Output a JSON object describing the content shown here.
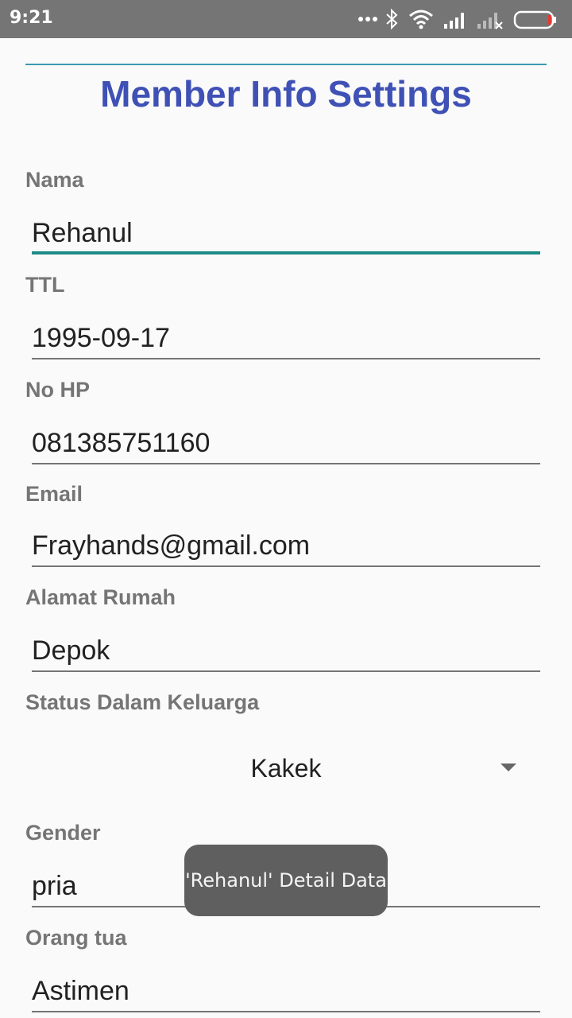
{
  "status_bar": {
    "time": "9:21",
    "icons": [
      "more-dots-icon",
      "bluetooth-icon",
      "wifi-icon",
      "signal-icon",
      "no-signal-icon",
      "battery-icon"
    ]
  },
  "page": {
    "title": "Member Info Settings",
    "accent_color": "#3f51b5",
    "focus_color": "#1e8c86"
  },
  "form": {
    "nama": {
      "label": "Nama",
      "value": "Rehanul"
    },
    "ttl": {
      "label": "TTL",
      "value": "1995-09-17"
    },
    "no_hp": {
      "label": "No HP",
      "value": "081385751160"
    },
    "email": {
      "label": "Email",
      "value": "Frayhands@gmail.com"
    },
    "alamat": {
      "label": "Alamat Rumah",
      "value": "Depok"
    },
    "status": {
      "label": "Status Dalam Keluarga",
      "selected": "Kakek"
    },
    "gender": {
      "label": "Gender",
      "value": "pria"
    },
    "orang_tua": {
      "label": "Orang tua",
      "value": "Astimen"
    }
  },
  "toast": {
    "message": "'Rehanul' Detail Data"
  }
}
